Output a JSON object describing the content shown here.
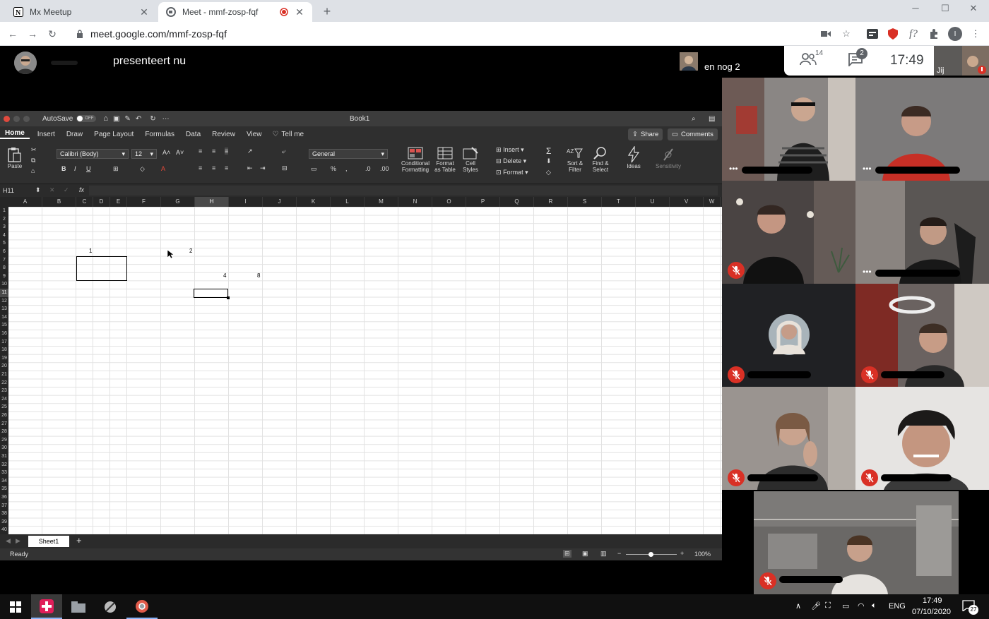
{
  "browser": {
    "tabs": [
      {
        "title": "Mx Meetup",
        "icon": "notion-icon"
      },
      {
        "title": "Meet - mmf-zosp-fqf",
        "icon": "meet-icon",
        "recording": true
      }
    ],
    "url": "meet.google.com/mmf-zosp-fqf"
  },
  "meet": {
    "presenter_label": "presenteert nu",
    "others_label": "en nog 2",
    "participants_count": "14",
    "chat_count": "2",
    "time": "17:49",
    "self_label": "Jij"
  },
  "excel": {
    "autosave": "AutoSave",
    "autosave_state": "OFF",
    "title": "Book1",
    "tabs": [
      "Home",
      "Insert",
      "Draw",
      "Page Layout",
      "Formulas",
      "Data",
      "Review",
      "View"
    ],
    "tell_me": "Tell me",
    "share": "Share",
    "comments": "Comments",
    "paste": "Paste",
    "font": "Calibri (Body)",
    "size": "12",
    "number_format": "General",
    "cond_format": [
      "Conditional",
      "Formatting"
    ],
    "format_table": [
      "Format",
      "as Table"
    ],
    "cell_styles": [
      "Cell",
      "Styles"
    ],
    "insert": "Insert",
    "delete": "Delete",
    "format": "Format",
    "sort_filter": [
      "Sort &",
      "Filter"
    ],
    "find_select": [
      "Find &",
      "Select"
    ],
    "ideas": "Ideas",
    "sensitivity": "Sensitivity",
    "name_box": "H11",
    "fx": "fx",
    "columns": [
      "A",
      "B",
      "C",
      "D",
      "E",
      "F",
      "G",
      "H",
      "I",
      "J",
      "K",
      "L",
      "M",
      "N",
      "O",
      "P",
      "Q",
      "R",
      "S",
      "T",
      "U",
      "V",
      "W"
    ],
    "rows": [
      "1",
      "2",
      "3",
      "4",
      "5",
      "6",
      "7",
      "8",
      "9",
      "10",
      "11",
      "12",
      "13",
      "14",
      "15",
      "16",
      "17",
      "18",
      "19",
      "20",
      "21",
      "22",
      "23",
      "24",
      "25",
      "26",
      "27",
      "28",
      "29",
      "30",
      "31",
      "32",
      "33",
      "34",
      "35",
      "36",
      "37",
      "38",
      "39",
      "40"
    ],
    "cells": {
      "c6": "1",
      "g6": "2",
      "h9": "4",
      "i9": "8"
    },
    "sheet": "Sheet1",
    "status": "Ready",
    "zoom": "100%"
  },
  "taskbar": {
    "lang": "ENG",
    "time": "17:49",
    "date": "07/10/2020",
    "notifications": "27"
  }
}
